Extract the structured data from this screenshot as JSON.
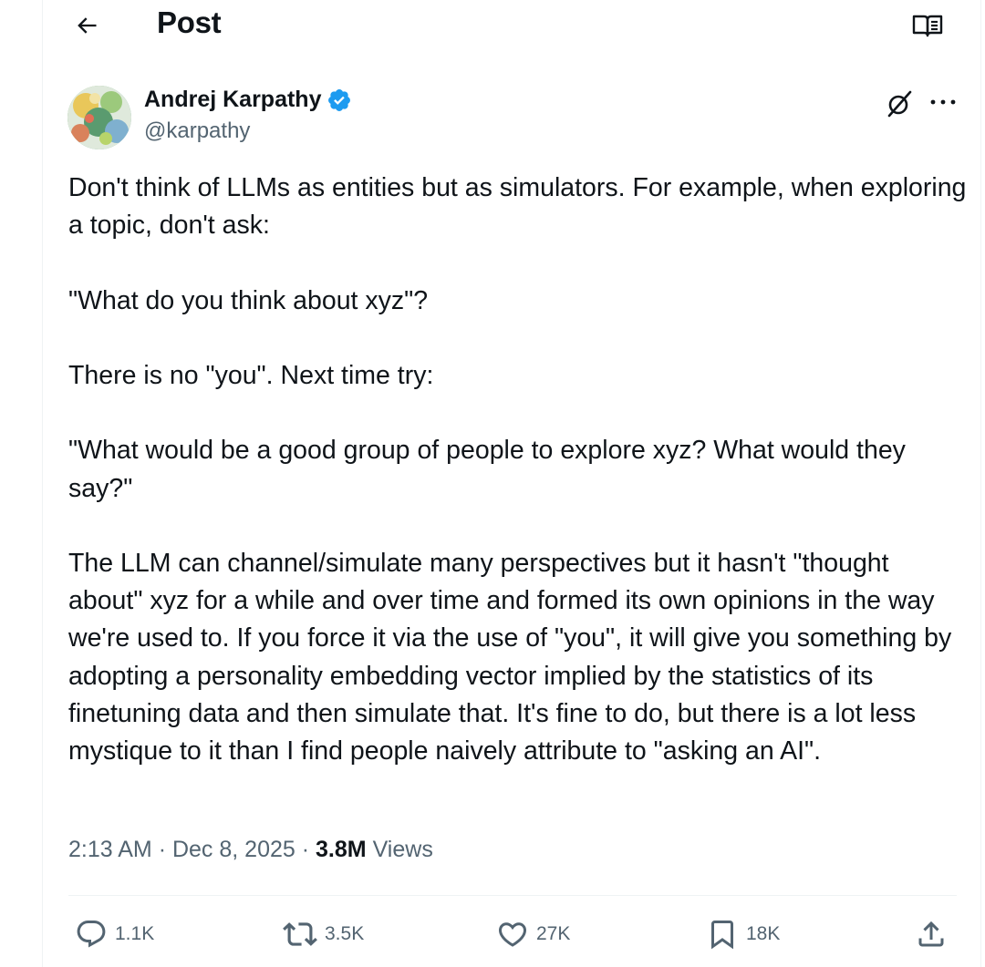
{
  "header": {
    "title": "Post",
    "back_icon": "arrow-left-icon",
    "reader_icon": "reader-mode-icon"
  },
  "author": {
    "name": "Andrej Karpathy",
    "handle": "@karpathy",
    "verified_color": "#1d9bf0"
  },
  "post": {
    "paragraphs": [
      "Don't think of LLMs as entities but as simulators. For example, when exploring a topic, don't ask:",
      "\"What do you think about xyz\"?",
      "There is no \"you\". Next time try:",
      "\"What would be a good group of people to explore xyz? What would they say?\"",
      "The LLM can channel/simulate many perspectives but it hasn't \"thought about\" xyz for a while and over time and formed its own opinions in the way we're used to. If you force it via the use of \"you\", it will give you something by adopting a personality embedding vector implied by the statistics of its finetuning data and then simulate that. It's fine to do, but there is a lot less mystique to it than I find people naively attribute to \"asking an AI\"."
    ]
  },
  "meta": {
    "time": "2:13 AM",
    "separator": "·",
    "date": "Dec 8, 2025",
    "views_count": "3.8M",
    "views_label": "Views"
  },
  "actions": {
    "replies": "1.1K",
    "reposts": "3.5K",
    "likes": "27K",
    "bookmarks": "18K"
  },
  "colors": {
    "text": "#0f1419",
    "secondary": "#536471",
    "border": "#eff3f4",
    "accent": "#1d9bf0"
  }
}
